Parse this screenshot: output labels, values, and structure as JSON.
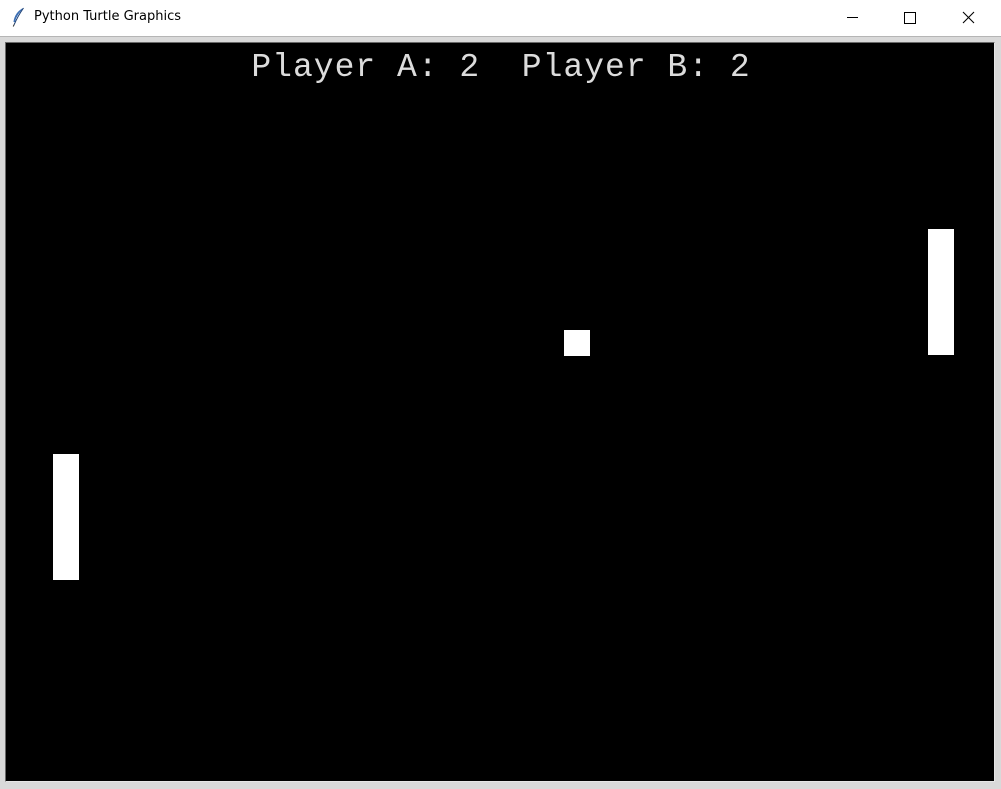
{
  "window": {
    "title": "Python Turtle Graphics",
    "icons": {
      "app": "feather-icon",
      "minimize": "minimize-icon",
      "maximize": "maximize-icon",
      "close": "close-icon"
    }
  },
  "game": {
    "score_text": "Player A: 2  Player B: 2",
    "player_a": {
      "label": "Player A",
      "score": 2
    },
    "player_b": {
      "label": "Player B",
      "score": 2
    },
    "colors": {
      "background": "#000000",
      "paddle": "#ffffff",
      "ball": "#ffffff",
      "score_text": "#dcdcdc"
    }
  }
}
